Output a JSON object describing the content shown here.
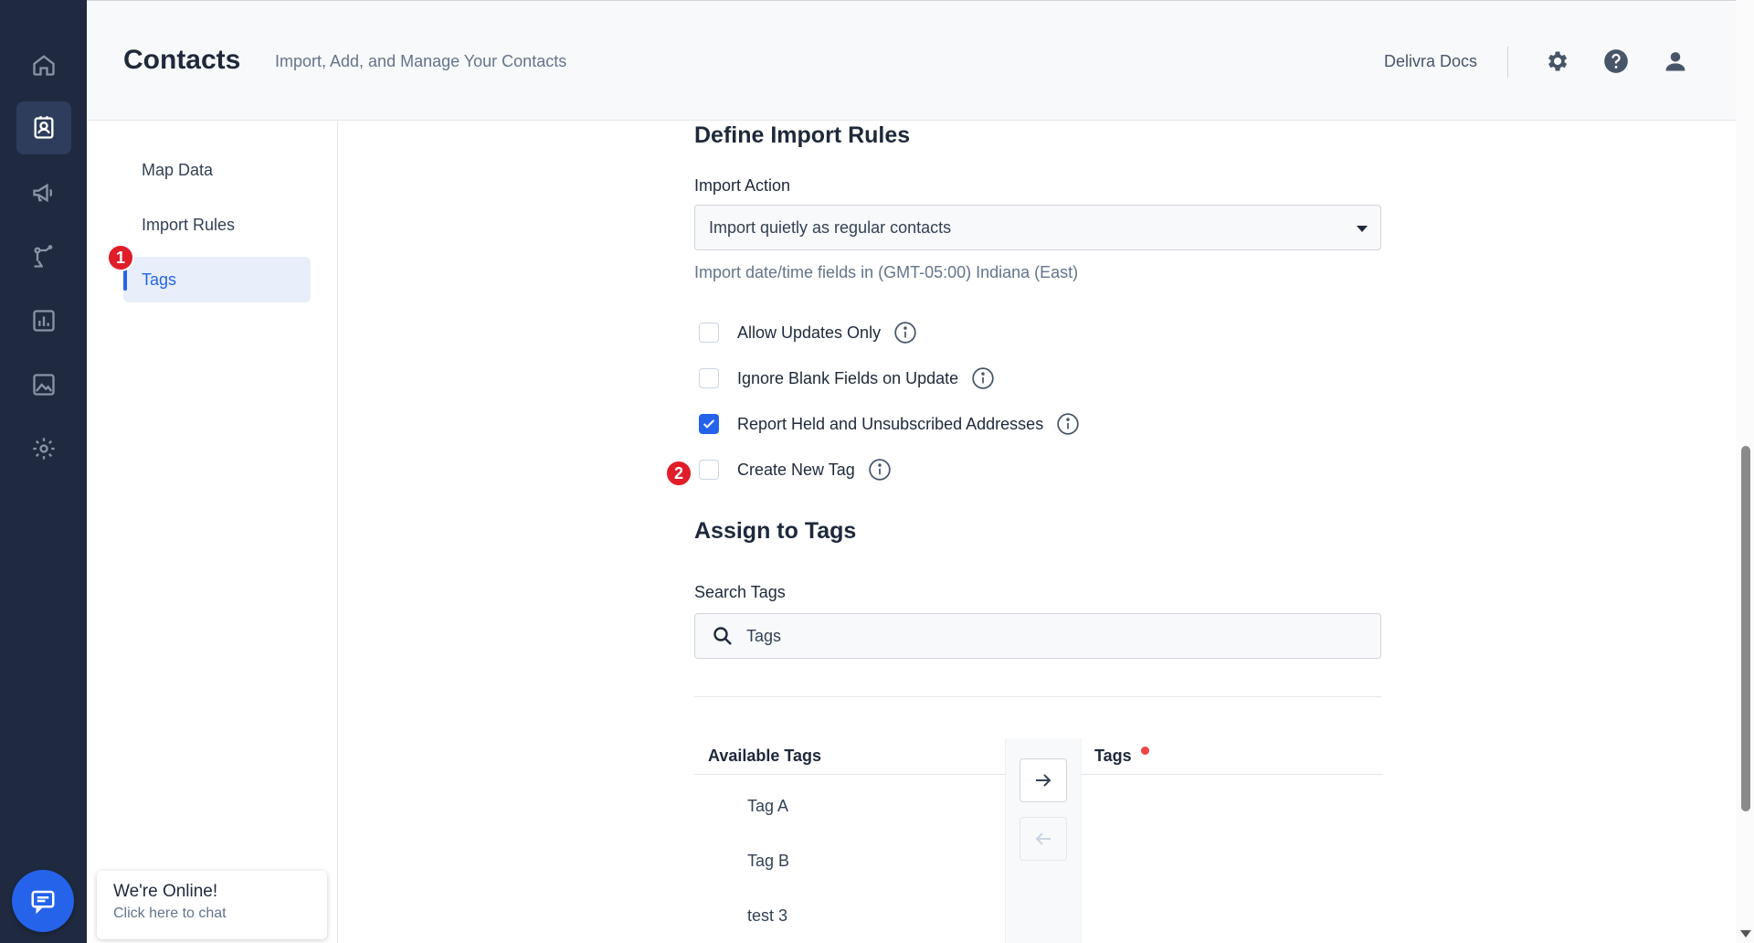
{
  "rail": {
    "items": [
      {
        "icon": "home-icon"
      },
      {
        "icon": "contacts-icon",
        "active": true
      },
      {
        "icon": "megaphone-icon"
      },
      {
        "icon": "automation-icon"
      },
      {
        "icon": "reports-icon"
      },
      {
        "icon": "image-icon"
      },
      {
        "icon": "gear-icon"
      }
    ]
  },
  "header": {
    "title": "Contacts",
    "subtitle": "Import, Add, and Manage Your Contacts",
    "docs_link": "Delivra Docs"
  },
  "subnav": {
    "items": [
      {
        "label": "Map Data"
      },
      {
        "label": "Import Rules"
      },
      {
        "label": "Tags",
        "active": true
      }
    ]
  },
  "badges": {
    "step1": "1",
    "step2": "2"
  },
  "import_rules": {
    "title": "Define Import Rules",
    "action_label": "Import Action",
    "action_value": "Import quietly as regular contacts",
    "timezone_hint": "Import date/time fields in (GMT-05:00) Indiana (East)",
    "options": [
      {
        "label": "Allow Updates Only",
        "checked": false
      },
      {
        "label": "Ignore Blank Fields on Update",
        "checked": false
      },
      {
        "label": "Report Held and Unsubscribed Addresses",
        "checked": true
      },
      {
        "label": "Create New Tag",
        "checked": false
      }
    ]
  },
  "assign_tags": {
    "title": "Assign to Tags",
    "search_label": "Search Tags",
    "search_placeholder": "Tags",
    "available_header": "Available Tags",
    "selected_header": "Tags",
    "available_tags": [
      "Tag A",
      "Tag B",
      "test 3"
    ]
  },
  "chat": {
    "title": "We're Online!",
    "subtitle": "Click here to chat"
  },
  "colors": {
    "rail_bg": "#1f2a40",
    "accent": "#2563eb",
    "badge_red": "#e11d2a"
  }
}
